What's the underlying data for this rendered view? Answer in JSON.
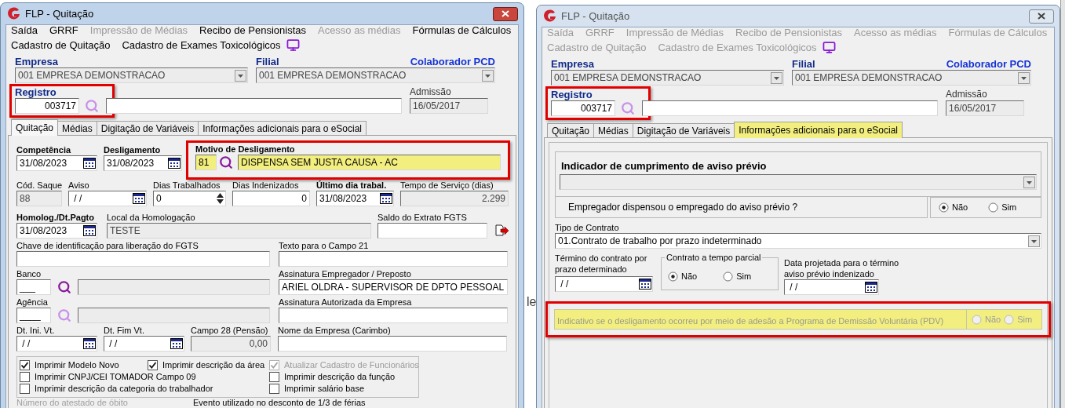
{
  "backdrop_text": "le",
  "windows": [
    {
      "title": "FLP - Quitação",
      "active": true,
      "menu": [
        {
          "items": [
            {
              "label": "Saída",
              "disabled": false
            },
            {
              "label": "GRRF",
              "disabled": false
            },
            {
              "label": "Impressão de Médias",
              "disabled": true
            },
            {
              "label": "Recibo de Pensionistas",
              "disabled": false
            },
            {
              "label": "Acesso as médias",
              "disabled": true
            },
            {
              "label": "Fórmulas de Cálculos",
              "disabled": false
            }
          ]
        },
        {
          "items": [
            {
              "label": "Cadastro de Quitação",
              "disabled": false
            },
            {
              "label": "Cadastro de Exames Toxicológicos",
              "disabled": false
            }
          ]
        }
      ],
      "empresa": {
        "label": "Empresa",
        "value": "001 EMPRESA DEMONSTRACAO",
        "disabled": true
      },
      "filial": {
        "label": "Filial",
        "value": "001 EMPRESA DEMONSTRACAO",
        "disabled": true
      },
      "pcd_link": "Colaborador PCD",
      "registro": {
        "label": "Registro",
        "value": "003717",
        "highlighted": true
      },
      "admissao": {
        "label": "Admissão",
        "value": "16/05/2017",
        "disabled": true
      },
      "tabs": [
        {
          "label": "Quitação",
          "selected": true,
          "highlighted": false
        },
        {
          "label": "Médias",
          "selected": false,
          "highlighted": false
        },
        {
          "label": "Digitação de Variáveis",
          "selected": false,
          "highlighted": false
        },
        {
          "label": "Informações adicionais para o eSocial",
          "selected": false,
          "highlighted": false
        }
      ],
      "panel": {
        "kind": "quitacao",
        "competencia": {
          "label": "Competência",
          "value": "31/08/2023",
          "required": true
        },
        "desligamento": {
          "label": "Desligamento",
          "value": "31/08/2023",
          "required": true
        },
        "motivo": {
          "label": "Motivo de Desligamento",
          "code": "81",
          "value": "DISPENSA SEM JUSTA CAUSA - AC",
          "required": true,
          "highlighted": true
        },
        "cod_saque": {
          "label": "Cód. Saque",
          "value": "88",
          "disabled": true
        },
        "aviso": {
          "label": "Aviso",
          "value": " / /"
        },
        "dias_trabalhados": {
          "label": "Dias Trabalhados",
          "value": "0"
        },
        "dias_indenizados": {
          "label": "Dias Indenizados",
          "value": "0"
        },
        "ultimo_dia": {
          "label": "Último dia trabal.",
          "value": "31/08/2023",
          "required": true
        },
        "tempo_servico": {
          "label": "Tempo de Serviço (dias)",
          "value": "2.299",
          "disabled": true
        },
        "homolog": {
          "label": "Homolog./Dt.Pagto",
          "value": "31/08/2023",
          "required": true
        },
        "local_homologacao": {
          "label": "Local da Homologação",
          "value": "TESTE",
          "disabled": true
        },
        "saldo_fgts": {
          "label": "Saldo do Extrato FGTS"
        },
        "chave_fgts": {
          "label": "Chave de identificação para liberação do FGTS"
        },
        "texto_campo21": {
          "label": "Texto para o Campo 21"
        },
        "banco": {
          "label": "Banco",
          "value": "___",
          "lookup_enabled": true
        },
        "assinatura_empregador": {
          "label": "Assinatura Empregador / Preposto",
          "value": "ARIEL OLDRA - SUPERVISOR DE DPTO PESSOAL"
        },
        "agencia": {
          "label": "Agência",
          "value": "____",
          "lookup_enabled": false
        },
        "assinatura_autorizada": {
          "label": "Assinatura Autorizada da Empresa"
        },
        "dt_ini_vt": {
          "label": "Dt. Ini. Vt.",
          "value": " / /"
        },
        "dt_fim_vt": {
          "label": "Dt. Fim Vt.",
          "value": " / /"
        },
        "campo28": {
          "label": "Campo 28 (Pensão)",
          "value": "0,00",
          "disabled": true
        },
        "nome_empresa": {
          "label": "Nome da Empresa (Carimbo)"
        },
        "checkbox_rows": [
          {
            "items": [
              {
                "label": "Imprimir Modelo Novo",
                "checked": true,
                "disabled": false
              },
              {
                "label": "Imprimir descrição da área",
                "checked": true,
                "disabled": false
              },
              {
                "label": "Atualizar Cadastro de Funcionários",
                "checked": true,
                "disabled": true
              }
            ]
          },
          {
            "items": [
              {
                "label": "Imprimir CNPJ/CEI TOMADOR Campo 09",
                "checked": false,
                "disabled": false
              },
              {
                "label": "Imprimir descrição da função",
                "checked": false,
                "disabled": false
              }
            ]
          },
          {
            "items": [
              {
                "label": "Imprimir descrição da categoria do trabalhador",
                "checked": false,
                "disabled": false
              },
              {
                "label": "Imprimir salário base",
                "checked": false,
                "disabled": false
              }
            ]
          }
        ],
        "bottom_labels": [
          {
            "label": "Número do atestado de óbito",
            "disabled": true
          },
          {
            "label": "Evento utilizado no desconto de 1/3 de férias",
            "disabled": false
          }
        ]
      }
    },
    {
      "title": "FLP - Quitação",
      "active": false,
      "menu": [
        {
          "items": [
            {
              "label": "Saída",
              "disabled": true
            },
            {
              "label": "GRRF",
              "disabled": true
            },
            {
              "label": "Impressão de Médias",
              "disabled": true
            },
            {
              "label": "Recibo de Pensionistas",
              "disabled": true
            },
            {
              "label": "Acesso as médias",
              "disabled": true
            },
            {
              "label": "Fórmulas de Cálculos",
              "disabled": true
            }
          ]
        },
        {
          "items": [
            {
              "label": "Cadastro de Quitação",
              "disabled": true
            },
            {
              "label": "Cadastro de Exames Toxicológicos",
              "disabled": true
            }
          ]
        }
      ],
      "empresa": {
        "label": "Empresa",
        "value": "001 EMPRESA DEMONSTRACAO",
        "disabled": true
      },
      "filial": {
        "label": "Filial",
        "value": "001 EMPRESA DEMONSTRACAO",
        "disabled": true
      },
      "pcd_link": "Colaborador PCD",
      "registro": {
        "label": "Registro",
        "value": "003717",
        "highlighted": true
      },
      "admissao": {
        "label": "Admissão",
        "value": "16/05/2017",
        "disabled": true
      },
      "tabs": [
        {
          "label": "Quitação",
          "selected": false,
          "highlighted": false
        },
        {
          "label": "Médias",
          "selected": false,
          "highlighted": false
        },
        {
          "label": "Digitação de Variáveis",
          "selected": false,
          "highlighted": false
        },
        {
          "label": "Informações adicionais para o eSocial",
          "selected": true,
          "highlighted": true
        }
      ],
      "panel": {
        "kind": "esocial",
        "indicador": {
          "label": "Indicador de cumprimento de aviso prévio",
          "disabled": true
        },
        "dispensa": {
          "question": "Empregador dispensou o empregado do aviso prévio ?",
          "options": [
            {
              "label": "Não",
              "selected": true
            },
            {
              "label": "Sim",
              "selected": false
            }
          ]
        },
        "tipo_contrato": {
          "label": "Tipo de Contrato",
          "value": "01.Contrato de trabalho por prazo indeterminado"
        },
        "termino": {
          "label": "Término do contrato por prazo determinado",
          "value": " / /"
        },
        "tempo_parcial": {
          "label": "Contrato a tempo parcial",
          "options": [
            {
              "label": "Não",
              "selected": true
            },
            {
              "label": "Sim",
              "selected": false
            }
          ]
        },
        "data_projetada": {
          "label": "Data projetada para o término aviso prévio indenizado",
          "value": " / /"
        },
        "pdv": {
          "question": "Indicativo se o desligamento ocorreu por meio de adesão a Programa de Demissão Voluntária (PDV)",
          "disabled": true,
          "highlighted": true,
          "options": [
            {
              "label": "Não",
              "selected": false
            },
            {
              "label": "Sim",
              "selected": false
            }
          ]
        }
      }
    }
  ]
}
